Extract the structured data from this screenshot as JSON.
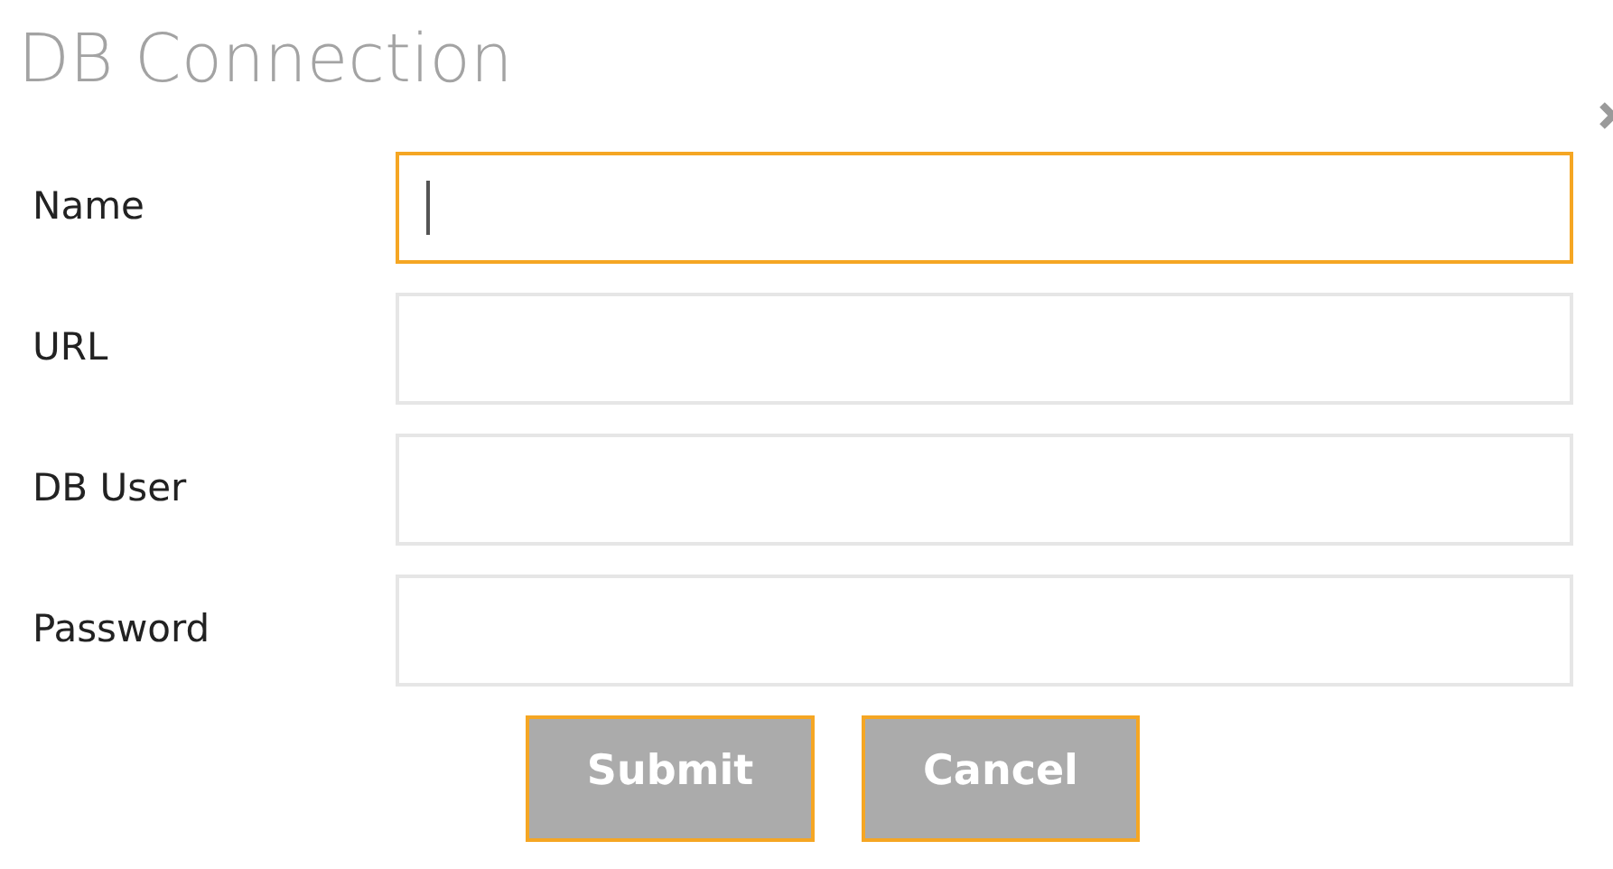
{
  "dialog": {
    "title": "DB Connection",
    "fields": [
      {
        "label": "Name",
        "focused": true
      },
      {
        "label": "URL",
        "focused": false
      },
      {
        "label": "DB User",
        "focused": false
      },
      {
        "label": "Password",
        "focused": false
      }
    ],
    "buttons": [
      "Submit",
      "Cancel"
    ]
  }
}
